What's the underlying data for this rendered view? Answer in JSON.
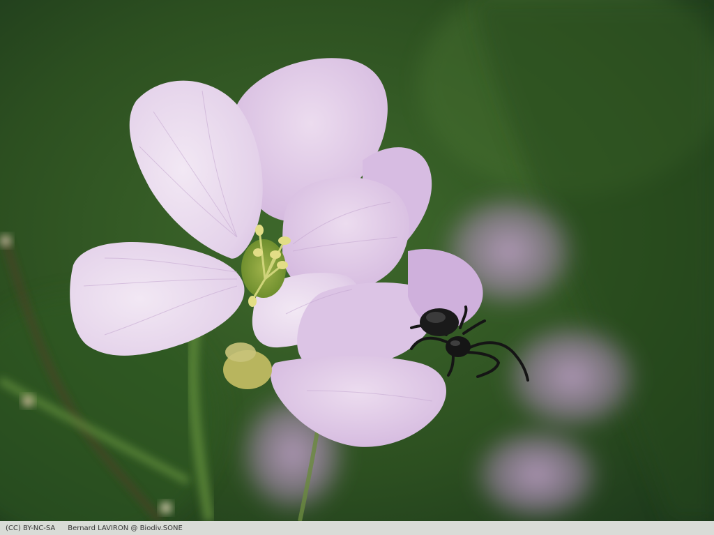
{
  "photo": {
    "subject": "pale pink flower with small black spider",
    "colors": {
      "background_dark": "#1d3a17",
      "background_mid": "#3f6a2c",
      "petal_light": "#eadcf0",
      "petal_mid": "#d9bfe3",
      "petal_vein": "#c3a5cf",
      "stamen": "#d9d77a",
      "stem": "#5f8a3a",
      "spider": "#151515"
    }
  },
  "caption": {
    "license": "(CC) BY-NC-SA",
    "credit": "Bernard LAVIRON @ Biodiv.SONE"
  }
}
